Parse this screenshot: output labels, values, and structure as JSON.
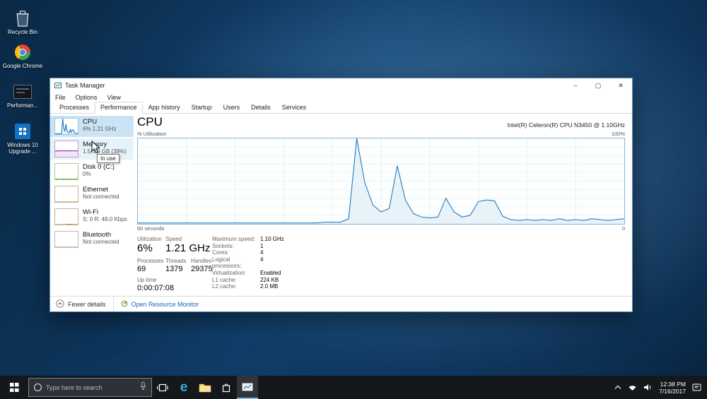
{
  "desktop": {
    "icons": [
      {
        "label": "Recycle Bin",
        "art": "recycle-bin"
      },
      {
        "label": "Google Chrome",
        "art": "chrome"
      },
      {
        "label": "Performan...",
        "art": "dark-app"
      },
      {
        "label": "Windows 10 Upgrade ...",
        "art": "win-upgrade"
      }
    ]
  },
  "window": {
    "title": "Task Manager",
    "controls": {
      "minimize": "–",
      "maximize": "▢",
      "close": "✕"
    },
    "menu": [
      "File",
      "Options",
      "View"
    ],
    "tabs": [
      "Processes",
      "Performance",
      "App history",
      "Startup",
      "Users",
      "Details",
      "Services"
    ],
    "active_tab": "Performance",
    "sidebar": [
      {
        "title": "CPU",
        "subtitle": "6% 1.21 GHz",
        "state": "selected",
        "line": "#1172b8",
        "fill": "#e7f2f9",
        "border": "#9cc6e2",
        "spark": [
          2,
          2,
          2,
          2,
          2,
          2,
          3,
          100,
          40,
          18,
          65,
          25,
          10,
          8,
          30,
          12,
          27,
          26,
          7,
          5,
          5,
          6
        ]
      },
      {
        "title": "Memory",
        "subtitle": "1.5/3.9 GB (38%)",
        "state": "hovered",
        "line": "#8b12a8",
        "fill": "#f2e6f5",
        "border": "#bf9cca",
        "spark": [
          37,
          37,
          38,
          38,
          38,
          38,
          38,
          38,
          38,
          38,
          38,
          38
        ]
      },
      {
        "title": "Disk 0 (C:)",
        "subtitle": "0%",
        "state": "",
        "line": "#4aa327",
        "fill": "#eef7ea",
        "border": "#a9c99a",
        "spark": [
          1,
          2,
          1,
          1,
          3,
          1,
          1,
          2,
          1,
          1,
          2,
          1
        ]
      },
      {
        "title": "Ethernet",
        "subtitle": "Not connected",
        "state": "",
        "line": "#a87f42",
        "fill": "#faf5ec",
        "border": "#c9b28c",
        "spark": [
          0,
          0,
          0,
          0,
          0,
          0,
          0,
          0,
          0,
          0,
          0,
          0
        ]
      },
      {
        "title": "Wi-Fi",
        "subtitle": "S: 0 R: 48.0 Kbps",
        "state": "",
        "line": "#a87f42",
        "fill": "#faf5ec",
        "border": "#c9b28c",
        "spark": [
          0,
          0,
          0,
          0,
          0,
          0,
          1,
          3,
          1,
          0,
          1,
          0
        ]
      },
      {
        "title": "Bluetooth",
        "subtitle": "Not connected",
        "state": "",
        "line": "#888888",
        "fill": "#f5f5f5",
        "border": "#bbbbbb",
        "spark": [
          0,
          0,
          0,
          0,
          0,
          0,
          0,
          0,
          0,
          0,
          0,
          0
        ]
      }
    ],
    "main": {
      "title": "CPU",
      "cpu_name": "Intel(R) Celeron(R) CPU N3450 @ 1.10GHz",
      "y_label": "% Utilization",
      "y_max": "100%",
      "x_left": "60 seconds",
      "x_right": "0",
      "stats": {
        "utilization": {
          "label": "Utilization",
          "value": "6%"
        },
        "speed": {
          "label": "Speed",
          "value": "1.21 GHz"
        },
        "processes": {
          "label": "Processes",
          "value": "69"
        },
        "threads": {
          "label": "Threads",
          "value": "1379"
        },
        "handles": {
          "label": "Handles",
          "value": "29375"
        },
        "uptime": {
          "label": "Up time",
          "value": "0:00:07:08"
        }
      },
      "details": [
        {
          "label": "Maximum speed:",
          "value": "1.10 GHz"
        },
        {
          "label": "Sockets:",
          "value": "1"
        },
        {
          "label": "Cores:",
          "value": "4"
        },
        {
          "label": "Logical processors:",
          "value": "4"
        },
        {
          "label": "Virtualization:",
          "value": "Enabled"
        },
        {
          "label": "L1 cache:",
          "value": "224 KB"
        },
        {
          "label": "L2 cache:",
          "value": "2.0 MB"
        }
      ]
    },
    "footer": {
      "fewer_details": "Fewer details",
      "open_resource_monitor": "Open Resource Monitor"
    }
  },
  "tooltip": "In use",
  "taskbar": {
    "search_placeholder": "Type here to search",
    "icons": [
      "start",
      "cortana-search",
      "microphone",
      "task-view",
      "edge",
      "file-explorer",
      "store",
      "task-manager",
      "tray-expand",
      "network",
      "volume",
      "action-center"
    ],
    "clock": {
      "time": "12:38 PM",
      "date": "7/16/2017"
    }
  },
  "chart_data": {
    "type": "area",
    "title": "CPU % Utilization over 60 seconds",
    "ylabel": "% Utilization",
    "ylim": [
      0,
      100
    ],
    "x_span_seconds": 60,
    "legend": "off",
    "grid": "on",
    "line_color": "#1172b8",
    "fill_color": "#e7f2f9",
    "values": [
      1,
      1,
      1,
      1,
      1,
      1,
      1,
      1,
      1,
      1,
      1,
      1,
      1,
      1,
      1,
      1,
      1,
      1,
      1,
      1,
      1,
      1,
      1,
      2,
      2,
      2,
      6,
      100,
      48,
      22,
      14,
      18,
      68,
      28,
      12,
      8,
      7,
      8,
      30,
      14,
      8,
      10,
      26,
      28,
      27,
      9,
      5,
      4,
      5,
      4,
      5,
      4,
      6,
      4,
      5,
      4,
      6,
      5,
      4,
      5,
      6
    ]
  }
}
